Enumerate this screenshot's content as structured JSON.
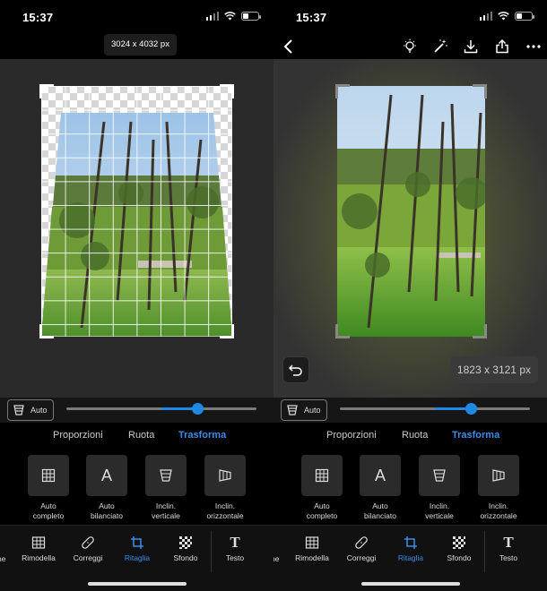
{
  "status": {
    "time": "15:37"
  },
  "left": {
    "dimensions_badge": "3024 x 4032 px"
  },
  "right": {
    "dimensions_badge": "1823 x 3121 px"
  },
  "transform": {
    "auto_label": "Auto",
    "slider_value": 0.69
  },
  "tabs": [
    {
      "label": "Proporzioni",
      "active": false
    },
    {
      "label": "Ruota",
      "active": false
    },
    {
      "label": "Trasforma",
      "active": true
    }
  ],
  "tools": [
    {
      "label": "Auto completo",
      "icon": "grid-icon"
    },
    {
      "label": "Auto bilanciato",
      "icon": "letter-a-icon"
    },
    {
      "label": "Inclin. verticale",
      "icon": "vertical-tilt-icon"
    },
    {
      "label": "Inclin. orizzontale",
      "icon": "horizontal-tilt-icon"
    }
  ],
  "nav": [
    {
      "label": "Rimodella",
      "icon": "reshape-icon",
      "active": false
    },
    {
      "label": "Correggi",
      "icon": "bandage-icon",
      "active": false
    },
    {
      "label": "Ritaglia",
      "icon": "crop-icon",
      "active": true
    },
    {
      "label": "Sfondo",
      "icon": "background-icon",
      "active": false
    },
    {
      "label": "Testo",
      "icon": "text-icon",
      "active": false
    }
  ],
  "nav_edge_text": "ne",
  "colors": {
    "accent": "#1e88e5",
    "active_text": "#3a8eea",
    "background": "#000000"
  }
}
